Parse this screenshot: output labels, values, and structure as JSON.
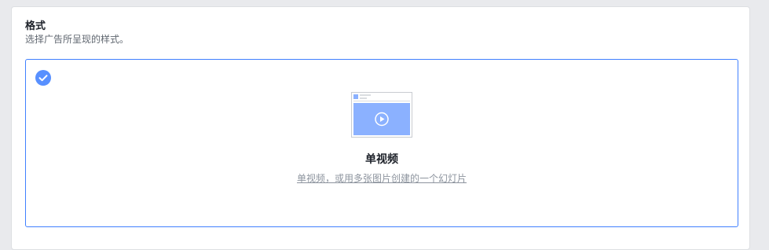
{
  "format_section": {
    "title": "格式",
    "subtitle": "选择广告所呈现的样式。"
  },
  "format_option": {
    "selected": true,
    "icon": "check-circle-icon",
    "thumbnail_icon": "single-video-thumbnail-icon",
    "title": "单视频",
    "description": "单视频，或用多张图片创建的一个幻灯片"
  },
  "colors": {
    "accent": "#4080ff",
    "check": "#5890ff",
    "thumbnail_fill": "#8bb1ff"
  }
}
